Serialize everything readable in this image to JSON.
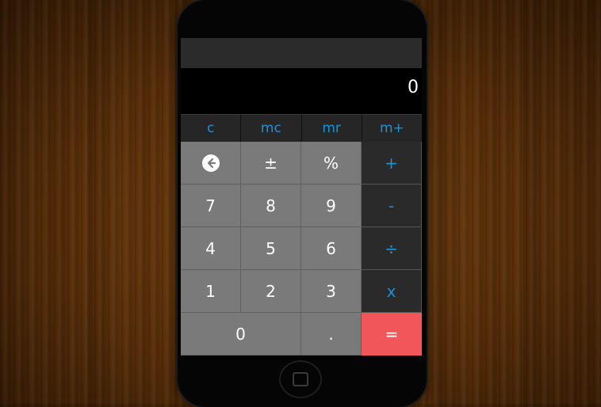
{
  "display": {
    "value": "0"
  },
  "memory_keys": [
    {
      "label": "c"
    },
    {
      "label": "mc"
    },
    {
      "label": "mr"
    },
    {
      "label": "m+"
    }
  ],
  "keys": {
    "backspace": {
      "icon": "arrow-left-circle-icon"
    },
    "plus_minus": "±",
    "percent": "%",
    "add": "+",
    "seven": "7",
    "eight": "8",
    "nine": "9",
    "subtract": "-",
    "four": "4",
    "five": "5",
    "six": "6",
    "divide": "÷",
    "one": "1",
    "two": "2",
    "three": "3",
    "multiply": "x",
    "zero": "0",
    "decimal": ".",
    "equals": "="
  },
  "colors": {
    "accent": "#1e90d6",
    "equals": "#f0565a",
    "number_key": "#7a7a7a",
    "operator_key": "#2a2a2a"
  }
}
